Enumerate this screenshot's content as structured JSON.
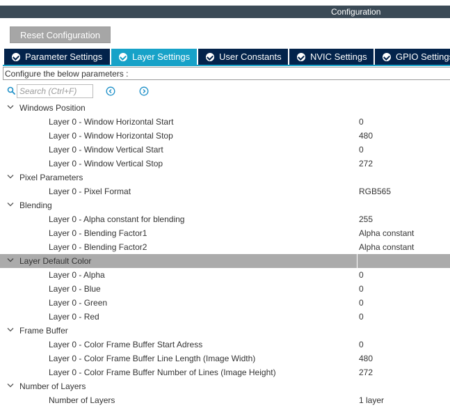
{
  "header": {
    "title": "Configuration"
  },
  "reset_button": "Reset Configuration",
  "tabs": [
    {
      "label": "Parameter Settings",
      "active": false
    },
    {
      "label": "Layer Settings",
      "active": true
    },
    {
      "label": "User Constants",
      "active": false
    },
    {
      "label": "NVIC Settings",
      "active": false
    },
    {
      "label": "GPIO Settings",
      "active": false
    }
  ],
  "configure_text": "Configure the below parameters :",
  "search": {
    "placeholder": "Search (Ctrl+F)"
  },
  "colors": {
    "header_bg": "#3b4a56",
    "tab_bg": "#03234b",
    "tab_active_bg": "#17a2c8",
    "highlight_row": "#ababab",
    "button_bg": "#a6a6a6"
  },
  "groups": [
    {
      "label": "Windows Position",
      "params": [
        {
          "label": "Layer 0 - Window Horizontal Start",
          "value": "0"
        },
        {
          "label": "Layer 0 - Window Horizontal Stop",
          "value": "480"
        },
        {
          "label": "Layer 0 - Window Vertical Start",
          "value": "0"
        },
        {
          "label": "Layer 0 - Window Vertical Stop",
          "value": "272"
        }
      ]
    },
    {
      "label": "Pixel Parameters",
      "params": [
        {
          "label": "Layer 0 - Pixel Format",
          "value": "RGB565"
        }
      ]
    },
    {
      "label": "Blending",
      "params": [
        {
          "label": "Layer 0 - Alpha constant for blending",
          "value": "255"
        },
        {
          "label": "Layer 0 - Blending Factor1",
          "value": "Alpha constant"
        },
        {
          "label": "Layer 0 - Blending Factor2",
          "value": "Alpha constant"
        }
      ]
    },
    {
      "label": "Layer Default Color",
      "highlighted": true,
      "params": [
        {
          "label": "Layer 0 - Alpha",
          "value": "0"
        },
        {
          "label": "Layer 0 - Blue",
          "value": "0"
        },
        {
          "label": "Layer 0 - Green",
          "value": "0"
        },
        {
          "label": "Layer 0 - Red",
          "value": "0"
        }
      ]
    },
    {
      "label": "Frame Buffer",
      "params": [
        {
          "label": "Layer 0 - Color Frame Buffer Start Adress",
          "value": "0"
        },
        {
          "label": "Layer 0 - Color Frame Buffer Line Length (Image Width)",
          "value": "480"
        },
        {
          "label": "Layer 0 - Color Frame Buffer Number of Lines (Image Height)",
          "value": "272"
        }
      ]
    },
    {
      "label": "Number of Layers",
      "params": [
        {
          "label": "Number of Layers",
          "value": "1 layer"
        }
      ]
    }
  ]
}
